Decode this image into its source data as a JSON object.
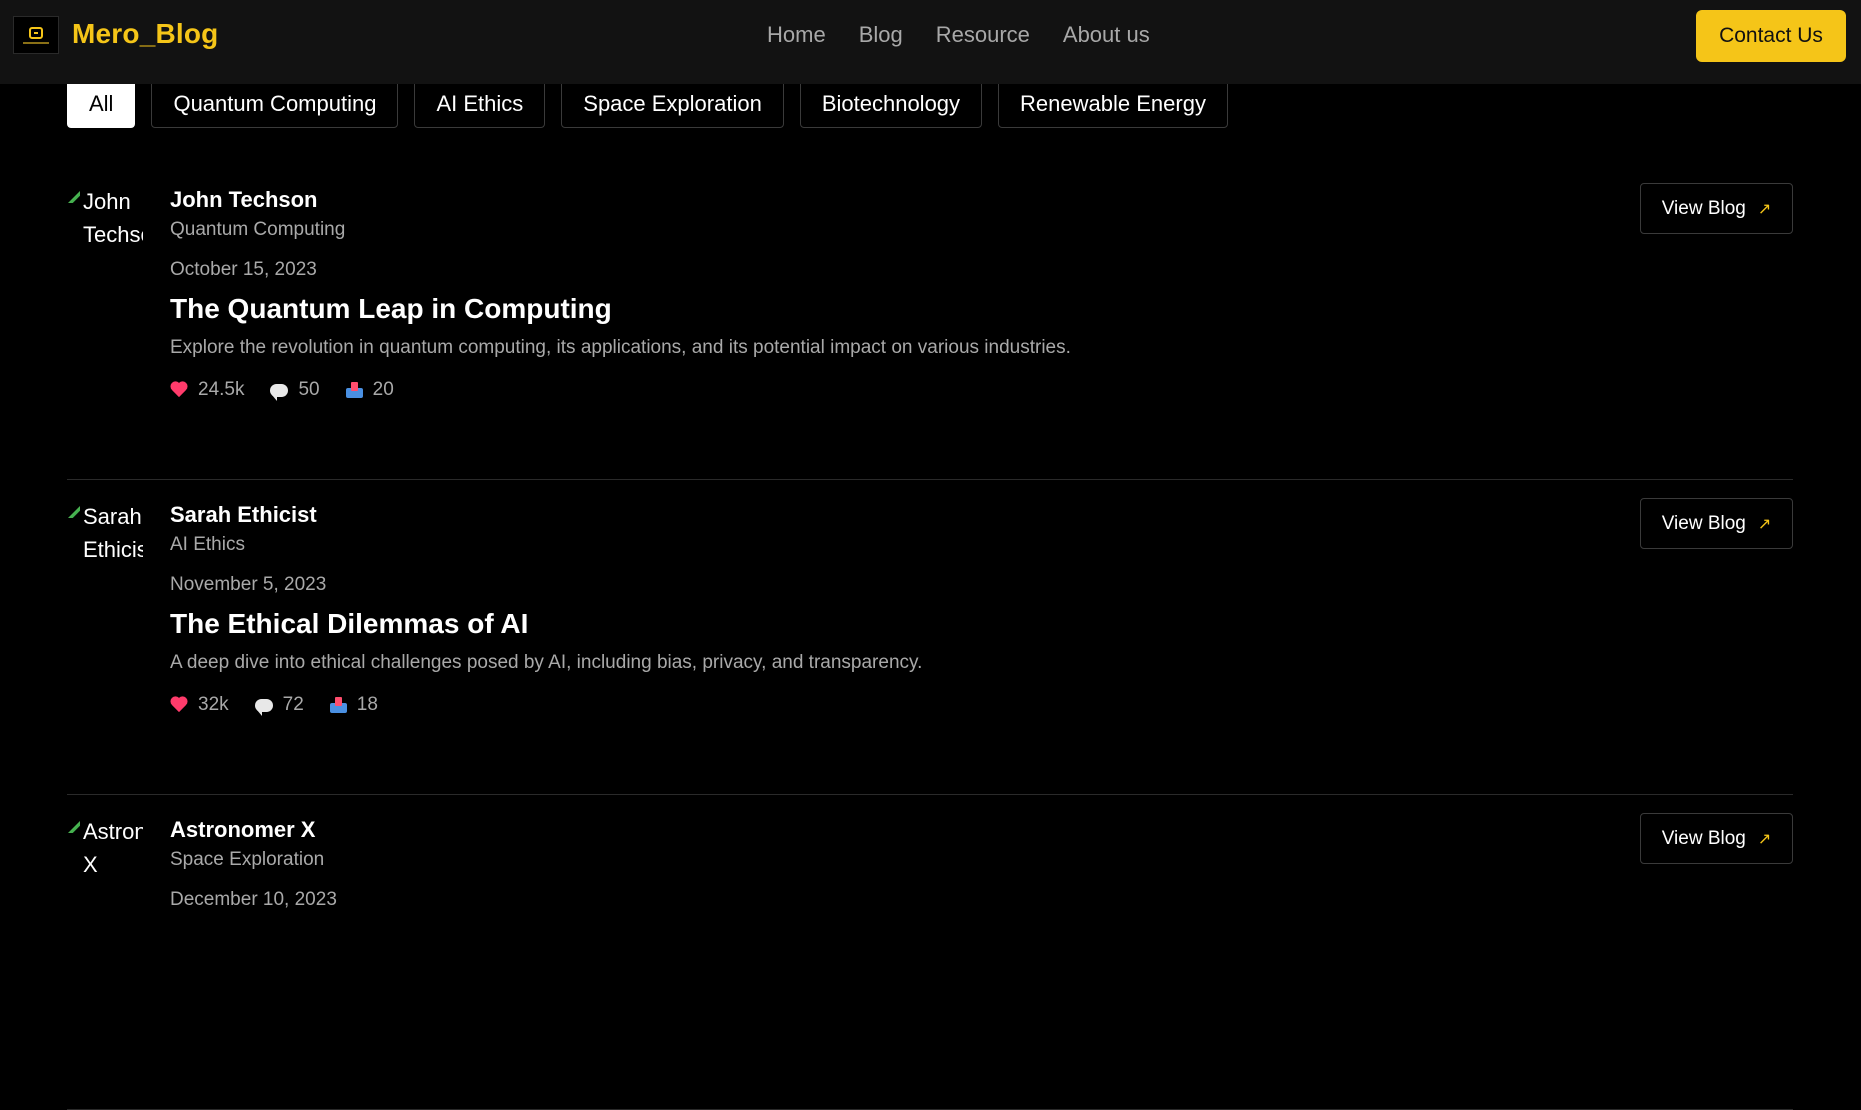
{
  "header": {
    "brand": "Mero_Blog",
    "nav": [
      "Home",
      "Blog",
      "Resource",
      "About us"
    ],
    "contact_label": "Contact Us"
  },
  "filters": {
    "items": [
      "All",
      "Quantum Computing",
      "AI Ethics",
      "Space Exploration",
      "Biotechnology",
      "Renewable Energy"
    ],
    "active": "All"
  },
  "posts": [
    {
      "author": "John Techson",
      "avatar_alt": "John Techson",
      "category": "Quantum Computing",
      "date": "October 15, 2023",
      "title": "The Quantum Leap in Computing",
      "excerpt": "Explore the revolution in quantum computing, its applications, and its potential impact on various industries.",
      "likes": "24.5k",
      "comments": "50",
      "shares": "20",
      "view_label": "View Blog"
    },
    {
      "author": "Sarah Ethicist",
      "avatar_alt": "Sarah Ethicist",
      "category": "AI Ethics",
      "date": "November 5, 2023",
      "title": "The Ethical Dilemmas of AI",
      "excerpt": "A deep dive into ethical challenges posed by AI, including bias, privacy, and transparency.",
      "likes": "32k",
      "comments": "72",
      "shares": "18",
      "view_label": "View Blog"
    },
    {
      "author": "Astronomer X",
      "avatar_alt": "Astronomer X",
      "category": "Space Exploration",
      "date": "December 10, 2023",
      "title": "",
      "excerpt": "",
      "likes": "",
      "comments": "",
      "shares": "",
      "view_label": "View Blog"
    }
  ],
  "colors": {
    "accent": "#f5c518",
    "background": "#000000",
    "header_bg": "#121212",
    "muted_text": "#a9a9a9",
    "heart": "#ff3b6b"
  },
  "icons": {
    "like": "heart-icon",
    "comment": "comment-bubble-icon",
    "share": "share-inbox-icon",
    "view": "arrow-up-right-icon"
  }
}
